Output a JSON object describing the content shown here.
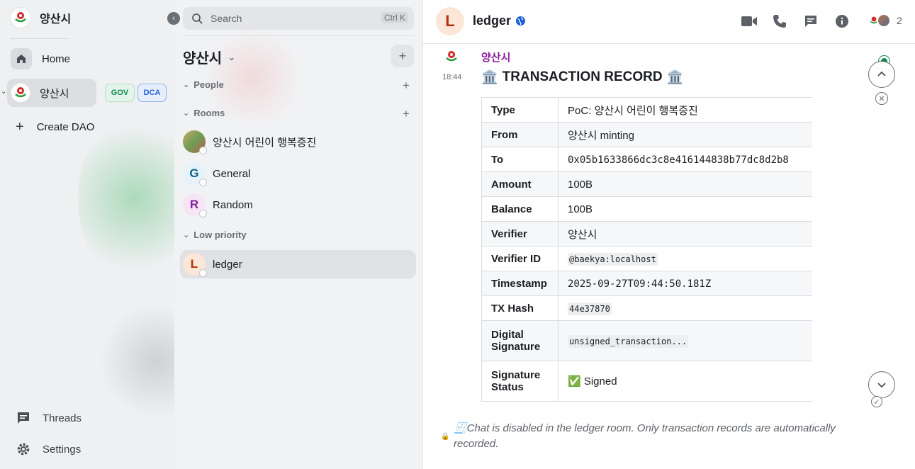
{
  "space": {
    "name": "양산시",
    "nav": {
      "home": "Home",
      "space_item": "양산시",
      "badges": [
        "GOV",
        "DCA"
      ],
      "create": "Create DAO"
    },
    "bottom": {
      "threads": "Threads",
      "settings": "Settings"
    }
  },
  "rooms": {
    "search_placeholder": "Search",
    "search_shortcut": "Ctrl K",
    "title": "양산시",
    "sections": {
      "people": "People",
      "rooms": "Rooms",
      "low_priority": "Low priority"
    },
    "list": [
      {
        "name": "양산시 어린이 행복증진",
        "initial": ""
      },
      {
        "name": "General",
        "initial": "G"
      },
      {
        "name": "Random",
        "initial": "R"
      }
    ],
    "low_priority_list": [
      {
        "name": "ledger",
        "initial": "L"
      }
    ]
  },
  "chat": {
    "room_name": "ledger",
    "room_initial": "L",
    "member_count": "2",
    "message": {
      "sender": "양산시",
      "time": "18:44",
      "title": "TRANSACTION RECORD",
      "title_icon": "🏛️"
    },
    "table": [
      {
        "key": "Type",
        "value": "PoC: 양산시 어린이 행복증진",
        "style": "text"
      },
      {
        "key": "From",
        "value": "양산시 minting",
        "style": "text"
      },
      {
        "key": "To",
        "value": "0x05b1633866dc3c8e416144838b77dc8d2b8",
        "style": "mono"
      },
      {
        "key": "Amount",
        "value": "100B",
        "style": "text"
      },
      {
        "key": "Balance",
        "value": "100B",
        "style": "text"
      },
      {
        "key": "Verifier",
        "value": "양산시",
        "style": "text"
      },
      {
        "key": "Verifier ID",
        "value": "@baekya:localhost",
        "style": "code"
      },
      {
        "key": "Timestamp",
        "value": "2025-09-27T09:44:50.181Z",
        "style": "mono"
      },
      {
        "key": "TX Hash",
        "value": "44e37870",
        "style": "code"
      },
      {
        "key": "Digital Signature",
        "value": "unsigned_transaction...",
        "style": "code"
      },
      {
        "key": "Signature Status",
        "value": "✅ Signed",
        "style": "text"
      }
    ],
    "footer_note": "🧾Chat is disabled in the ledger room. Only transaction records are automatically recorded."
  },
  "colors": {
    "accent_green": "#0b8a4b",
    "sender_purple": "#8a1d9e",
    "dca_blue": "#1f5fd6"
  },
  "icons": [
    "search-icon",
    "home-icon",
    "plus-icon",
    "chevron-down-icon",
    "video-call-icon",
    "voice-call-icon",
    "threads-icon",
    "info-icon",
    "globe-icon",
    "settings-icon",
    "scroll-up-icon",
    "scroll-down-icon",
    "close-icon",
    "check-icon"
  ]
}
